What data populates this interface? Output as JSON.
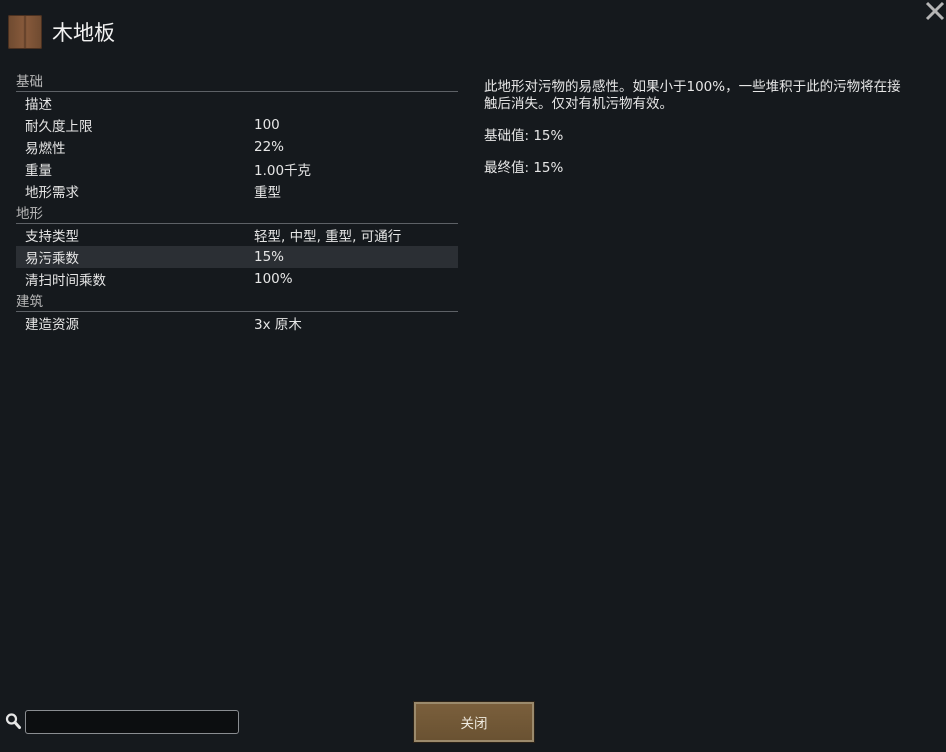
{
  "window": {
    "title": "木地板",
    "icon": "wood-floor-icon"
  },
  "stats": {
    "categories": [
      {
        "name": "基础",
        "rows": [
          {
            "label": "描述",
            "value": ""
          },
          {
            "label": "耐久度上限",
            "value": "100"
          },
          {
            "label": "易燃性",
            "value": "22%"
          },
          {
            "label": "重量",
            "value": "1.00千克"
          },
          {
            "label": "地形需求",
            "value": "重型"
          }
        ]
      },
      {
        "name": "地形",
        "rows": [
          {
            "label": "支持类型",
            "value": "轻型, 中型, 重型, 可通行"
          },
          {
            "label": "易污乘数",
            "value": "15%",
            "selected": true
          },
          {
            "label": "清扫时间乘数",
            "value": "100%"
          }
        ]
      },
      {
        "name": "建筑",
        "rows": [
          {
            "label": "建造资源",
            "value": "3x 原木"
          }
        ]
      }
    ]
  },
  "description": {
    "text": "此地形对污物的易感性。如果小于100%，一些堆积于此的污物将在接触后消失。仅对有机污物有效。",
    "base_value": "基础值: 15%",
    "final_value": "最终值: 15%"
  },
  "footer": {
    "search_placeholder": "",
    "search_value": "",
    "close_label": "关闭"
  },
  "colors": {
    "background": "#15191d",
    "selected_row": "#2b2f34",
    "button": "#6f5636"
  }
}
